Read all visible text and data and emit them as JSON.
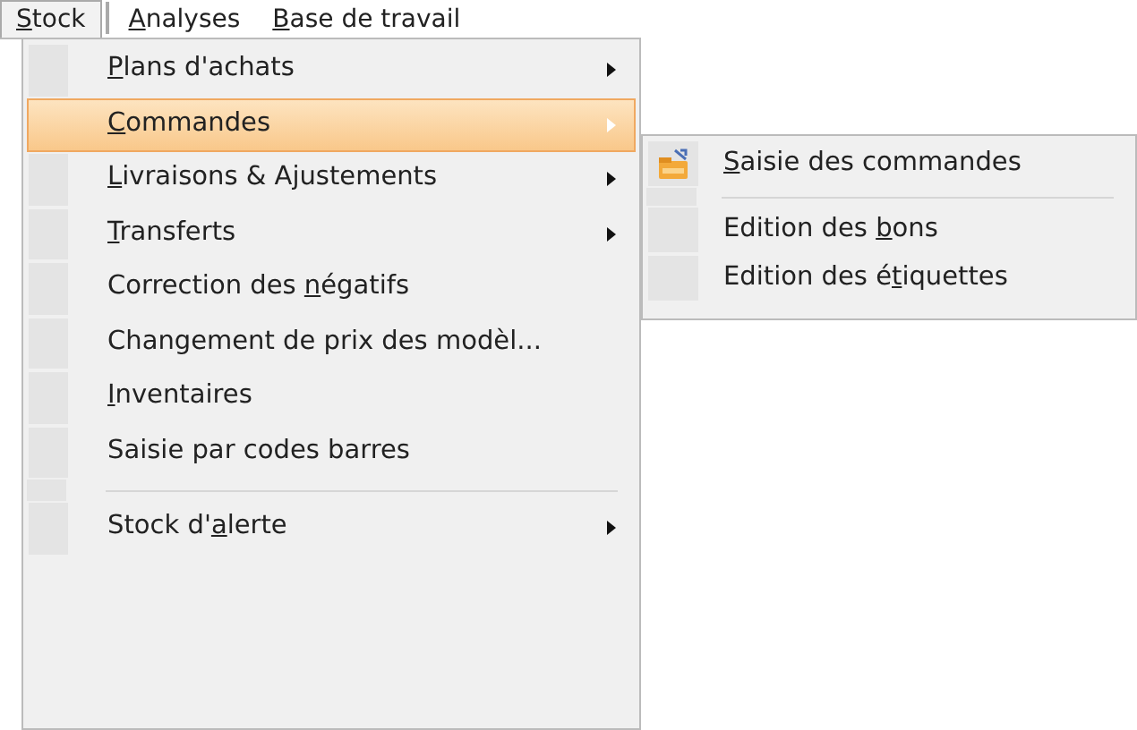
{
  "menu_bar": [
    {
      "mnemonic": "S",
      "label_after": "tock",
      "selected": true
    },
    {
      "mnemonic": "A",
      "label_after": "nalyses",
      "selected": false
    },
    {
      "mnemonic": "B",
      "label_after": "ase de travail",
      "selected": false
    }
  ],
  "menu": {
    "items": [
      {
        "kind": "submenu",
        "mnemonic": "P",
        "label_after": "lans d'achats",
        "selected": false
      },
      {
        "kind": "submenu",
        "mnemonic": "C",
        "label_after": "ommandes",
        "selected": true
      },
      {
        "kind": "submenu",
        "mnemonic": "L",
        "label_after": "ivraisons & Ajustements",
        "selected": false
      },
      {
        "kind": "submenu",
        "mnemonic": "T",
        "label_after": "ransferts",
        "selected": false
      },
      {
        "kind": "command",
        "label_before": "Correction des ",
        "mnemonic": "n",
        "label_after": "égatifs",
        "selected": false
      },
      {
        "kind": "command",
        "label_before": "Changement de prix des modèl...",
        "selected": false
      },
      {
        "kind": "command",
        "mnemonic": "I",
        "label_after": "nventaires",
        "selected": false
      },
      {
        "kind": "command",
        "label_before": "Saisie par codes barres",
        "selected": false
      },
      {
        "kind": "separator"
      },
      {
        "kind": "submenu",
        "label_before": "Stock d'",
        "mnemonic": "a",
        "label_after": "lerte",
        "selected": false
      }
    ]
  },
  "submenu": {
    "items": [
      {
        "kind": "command",
        "mnemonic": "S",
        "label_after": "aisie des commandes",
        "has_icon": true,
        "selected": false
      },
      {
        "kind": "separator"
      },
      {
        "kind": "command",
        "label_before": "Edition des ",
        "mnemonic": "b",
        "label_after": "ons",
        "selected": false
      },
      {
        "kind": "command",
        "label_before": "Edition des é",
        "mnemonic": "t",
        "label_after": "iquettes",
        "selected": false
      }
    ]
  }
}
